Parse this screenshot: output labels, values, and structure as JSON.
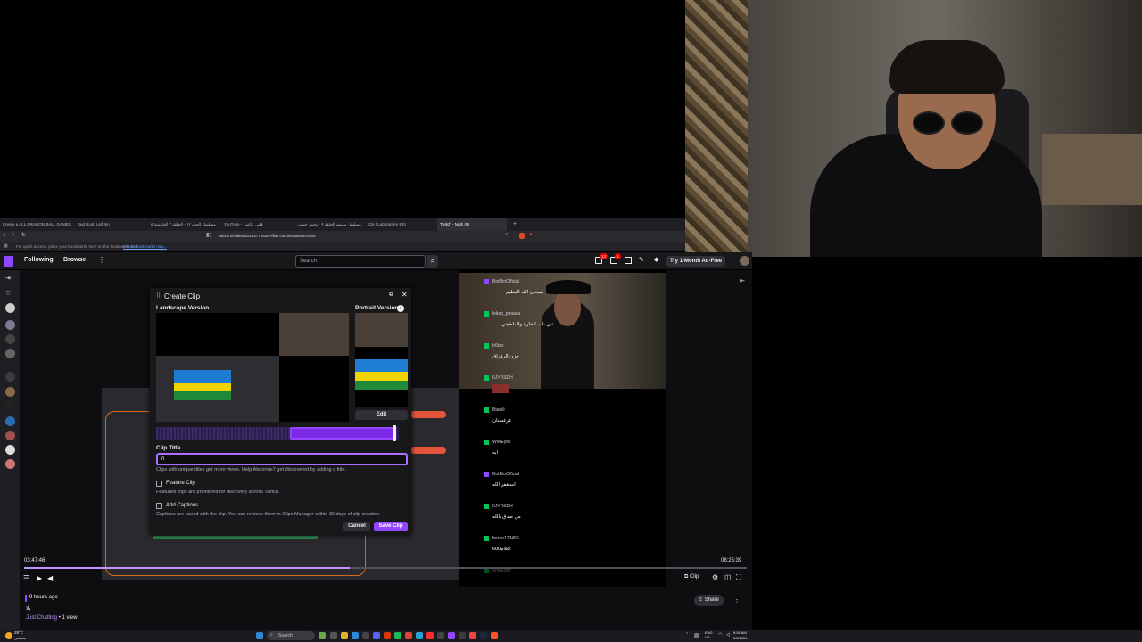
{
  "browser": {
    "tabs": [
      {
        "label": "Create a ALL DRAGON BALL GAMES"
      },
      {
        "label": "Sed Boot! Leif Inn"
      },
      {
        "label": "مسلسل الحب ١٢ - الحلقة ٣ الخامسة ٥"
      },
      {
        "label": "YouTube - قلبي عالمي"
      },
      {
        "label": "مسلسل موسم الحلقة ٩ - محمد حسين"
      },
      {
        "label": "Clé | Laboratoire ESI"
      },
      {
        "label": "Twitch - Nath (5)"
      }
    ],
    "url": "twitch.tv/videos/2254770638?filter=archives&sort=time",
    "bookmarks_text": "For quick access, place your bookmarks here on the bookmarks bar.",
    "bookmarks_link": "Import bookmarks now..."
  },
  "twitch": {
    "nav_following": "Following",
    "nav_browse": "Browse",
    "search_placeholder": "Search",
    "notif_count_1": "13",
    "notif_count_2": "1",
    "ad_free": "Try 1-Month Ad-Free",
    "time_current": "03:47:46",
    "time_total": "08:25:39",
    "clip_label": "Clip",
    "stream_age": "9 hours ago",
    "stream_title": "يلا",
    "category": "Just Chatting",
    "views": " • 1 view",
    "share_label": "Share"
  },
  "chat": [
    {
      "user": "BotRioOfficial",
      "msg": "سبحان الله العظيم"
    },
    {
      "user": "lekab_piraaca",
      "msg": "تبي باب الحارة ولا بلطجي"
    },
    {
      "user": "Ir6tax",
      "msg": "حزن الرقراق"
    },
    {
      "user": "IIJYRSDH",
      "msg": ""
    },
    {
      "user": "Btaeili",
      "msg": "غرغستان"
    },
    {
      "user": "WWEybk",
      "msg": "ايه"
    },
    {
      "user": "BotRioOfficial",
      "msg": "استغفر الله"
    },
    {
      "user": "IIJYRSDH",
      "msg": "من صدق بالله"
    },
    {
      "user": "fwzan123456",
      "msg": "اعلام600"
    },
    {
      "user": "WWEybk",
      "msg": ""
    }
  ],
  "dialog": {
    "title": "Create Clip",
    "landscape": "Landscape Version",
    "portrait": "Portrait Version",
    "edit": "Edit",
    "clip_title_label": "Clip Title",
    "clip_title_value": "ñ",
    "hint": "Clips with unique titles get more views. Help Aboorme7 get discovered by adding a title.",
    "feature_label": "Feature Clip",
    "feature_desc": "Featured clips are prioritized for discovery across Twitch.",
    "captions_label": "Add Captions",
    "captions_desc": "Captions are saved with the clip. You can remove them in Clips Manager within 30 days of clip creation.",
    "cancel": "Cancel",
    "save": "Save Clip"
  },
  "taskbar": {
    "weather": "29°C",
    "weather_desc": "مشمس",
    "search": "Search",
    "lang": "ENG US",
    "time": "9:51 AM",
    "date": "8/2/2024"
  },
  "colors": {
    "twitch_purple": "#9147ff",
    "bg": "#0e0e10",
    "chat_badge": "#00c853"
  },
  "progress": {
    "played_fraction": 0.45
  }
}
